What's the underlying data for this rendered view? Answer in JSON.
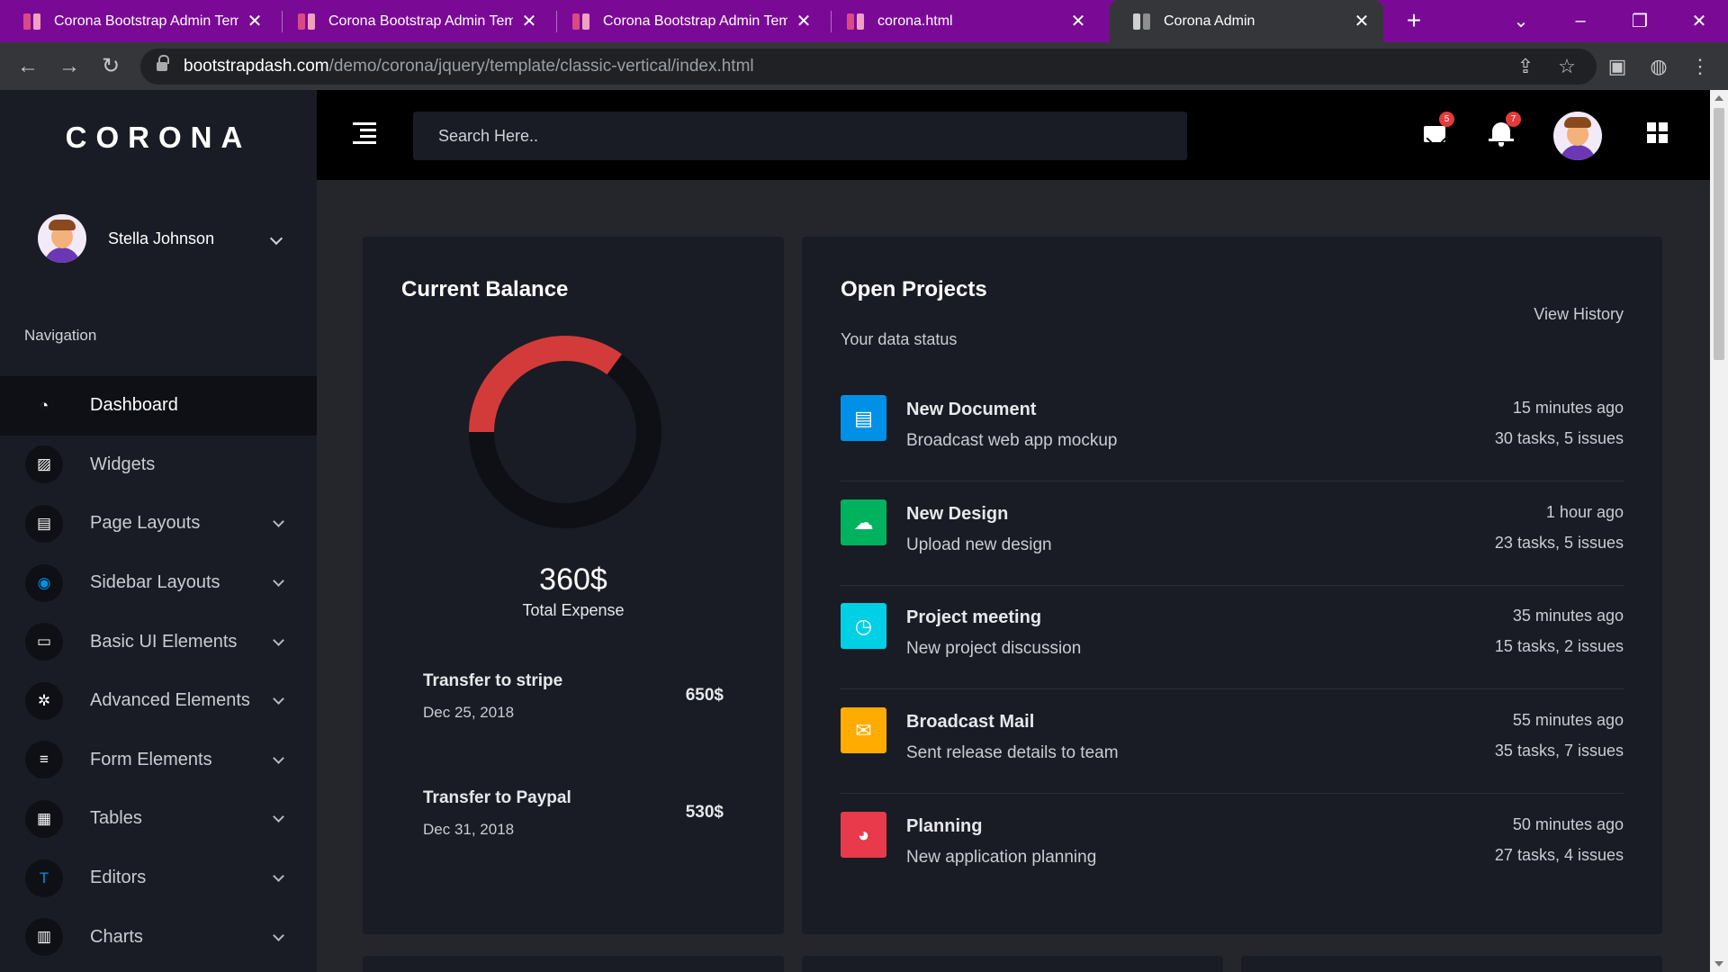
{
  "browser": {
    "tabs": [
      {
        "title": "Corona Bootstrap Admin Temp",
        "active": false
      },
      {
        "title": "Corona Bootstrap Admin Temp",
        "active": false
      },
      {
        "title": "Corona Bootstrap Admin Temp",
        "active": false
      },
      {
        "title": "corona.html",
        "active": false
      },
      {
        "title": "Corona Admin",
        "active": true
      }
    ],
    "url_host": "bootstrapdash.com",
    "url_path": "/demo/corona/jquery/template/classic-vertical/index.html"
  },
  "sidebar": {
    "brand": "CORONA",
    "user_name": "Stella Johnson",
    "nav_heading": "Navigation",
    "items": [
      {
        "label": "Dashboard",
        "icon": "speedometer-icon",
        "icon_color": "#ffffff"
      },
      {
        "label": "Widgets",
        "icon": "widgets-icon",
        "icon_color": "#ffffff"
      },
      {
        "label": "Page Layouts",
        "icon": "layout-icon",
        "icon_color": "#ffffff"
      },
      {
        "label": "Sidebar Layouts",
        "icon": "sidebar-icon",
        "icon_color": "#0090e7"
      },
      {
        "label": "Basic UI Elements",
        "icon": "laptop-icon",
        "icon_color": "#ffffff"
      },
      {
        "label": "Advanced Elements",
        "icon": "settings-icon",
        "icon_color": "#ffffff"
      },
      {
        "label": "Form Elements",
        "icon": "form-icon",
        "icon_color": "#ffffff"
      },
      {
        "label": "Tables",
        "icon": "table-icon",
        "icon_color": "#ffffff"
      },
      {
        "label": "Editors",
        "icon": "format-text-icon",
        "icon_color": "#0090e7"
      },
      {
        "label": "Charts",
        "icon": "chart-bar-icon",
        "icon_color": "#ffffff"
      }
    ]
  },
  "topnav": {
    "search_placeholder": "Search Here..",
    "mail_count": "5",
    "notification_count": "7"
  },
  "balance": {
    "title": "Current Balance",
    "amount": "360$",
    "label": "Total Expense",
    "donut_fraction": 0.35,
    "donut_colors": {
      "filled": "#d33b3b",
      "track": "#0f1015"
    },
    "transactions": [
      {
        "name": "Transfer to stripe",
        "date": "Dec 25, 2018",
        "amount": "650$"
      },
      {
        "name": "Transfer to Paypal",
        "date": "Dec 31, 2018",
        "amount": "530$"
      }
    ]
  },
  "projects": {
    "title": "Open Projects",
    "subtitle": "Your data status",
    "view_history": "View History",
    "items": [
      {
        "name": "New Document",
        "desc": "Broadcast web app mockup",
        "time": "15 minutes ago",
        "tasks": "30 tasks, 5 issues",
        "icon": "file-document-icon",
        "color": "#0090e7"
      },
      {
        "name": "New Design",
        "desc": "Upload new design",
        "time": "1 hour ago",
        "tasks": "23 tasks, 5 issues",
        "icon": "cloud-upload-icon",
        "color": "#00b15e"
      },
      {
        "name": "Project meeting",
        "desc": "New project discussion",
        "time": "35 minutes ago",
        "tasks": "15 tasks, 2 issues",
        "icon": "clock-icon",
        "color": "#00d0e6"
      },
      {
        "name": "Broadcast Mail",
        "desc": "Sent release details to team",
        "time": "55 minutes ago",
        "tasks": "35 tasks, 7 issues",
        "icon": "email-icon",
        "color": "#ffab00"
      },
      {
        "name": "Planning",
        "desc": "New application planning",
        "time": "50 minutes ago",
        "tasks": "27 tasks, 4 issues",
        "icon": "chart-pie-icon",
        "color": "#e83a4a"
      }
    ]
  }
}
